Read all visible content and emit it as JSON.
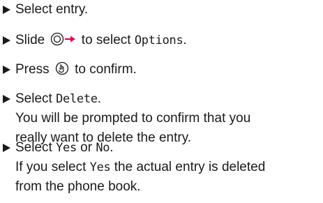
{
  "steps": [
    {
      "lines": [
        {
          "parts": [
            {
              "t": "Select entry."
            }
          ]
        }
      ]
    },
    {
      "lines": [
        {
          "parts": [
            {
              "t": "Slide "
            },
            {
              "icon": "nav-key-right-icon"
            },
            {
              "t": " to select "
            },
            {
              "m": "Options"
            },
            {
              "t": "."
            }
          ]
        }
      ]
    },
    {
      "lines": [
        {
          "parts": [
            {
              "t": "Press "
            },
            {
              "icon": "press-key-icon"
            },
            {
              "t": " to confirm."
            }
          ]
        }
      ]
    },
    {
      "lines": [
        {
          "parts": [
            {
              "t": "Select "
            },
            {
              "m": "Delete"
            },
            {
              "t": "."
            }
          ]
        },
        {
          "parts": [
            {
              "t": "You will be prompted to confirm that you"
            }
          ]
        },
        {
          "parts": [
            {
              "t": "really want to delete the entry."
            }
          ]
        }
      ]
    },
    {
      "lines": [
        {
          "parts": [
            {
              "t": "Select "
            },
            {
              "m": "Yes"
            },
            {
              "t": " or "
            },
            {
              "m": "No"
            },
            {
              "t": "."
            }
          ]
        },
        {
          "parts": [
            {
              "t": "If you select "
            },
            {
              "m": "Yes"
            },
            {
              "t": " the actual entry is deleted"
            }
          ]
        },
        {
          "parts": [
            {
              "t": "from the phone book."
            }
          ]
        }
      ]
    }
  ]
}
